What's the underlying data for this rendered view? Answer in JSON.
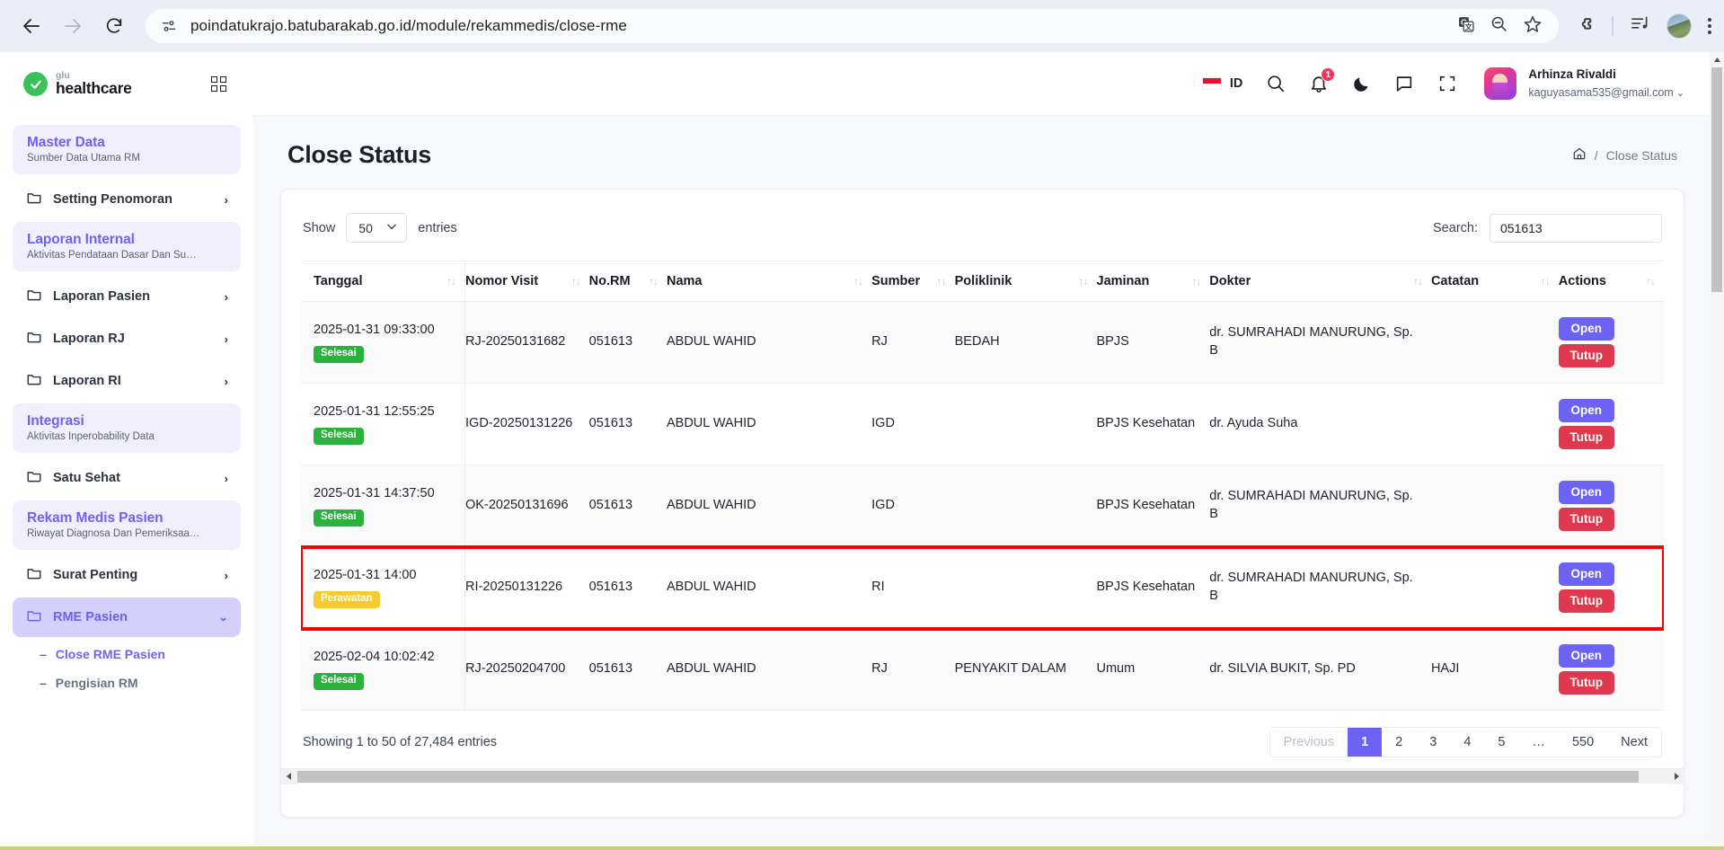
{
  "browser": {
    "url": "poindatukrajo.batubarakab.go.id/module/rekammedis/close-rme",
    "back_label": "Back",
    "forward_label": "Forward",
    "reload_label": "Reload",
    "icons": {
      "site_info": "site-info-icon",
      "translate": "translate-icon",
      "zoom_out": "zoom-out-icon",
      "bookmark": "star-icon",
      "extensions": "puzzle-icon",
      "media": "media-playlist-icon",
      "profile": "chrome-profile-avatar",
      "menu": "kebab-menu-icon"
    }
  },
  "sidebar": {
    "brand": {
      "glu": "glu",
      "name": "healthcare",
      "grid_label": "Apps"
    },
    "groups": [
      {
        "type": "section",
        "title": "Master Data",
        "sub": "Sumber Data Utama RM"
      },
      {
        "type": "item",
        "label": "Setting Penomoran",
        "active": false
      },
      {
        "type": "section",
        "title": "Laporan Internal",
        "sub": "Aktivitas Pendataan Dasar Dan Su…"
      },
      {
        "type": "item",
        "label": "Laporan Pasien",
        "active": false
      },
      {
        "type": "item",
        "label": "Laporan RJ",
        "active": false
      },
      {
        "type": "item",
        "label": "Laporan RI",
        "active": false
      },
      {
        "type": "section",
        "title": "Integrasi",
        "sub": "Aktivitas Inperobability Data"
      },
      {
        "type": "item",
        "label": "Satu Sehat",
        "active": false
      },
      {
        "type": "section",
        "title": "Rekam Medis Pasien",
        "sub": "Riwayat Diagnosa Dan Pemeriksaa…"
      },
      {
        "type": "item",
        "label": "Surat Penting",
        "active": false
      },
      {
        "type": "item",
        "label": "RME Pasien",
        "active": true
      },
      {
        "type": "sub",
        "label": "Close RME Pasien",
        "active": true
      },
      {
        "type": "sub",
        "label": "Pengisian RM",
        "active": false
      }
    ]
  },
  "topbar": {
    "language": "ID",
    "notification_count": "1",
    "user": {
      "name": "Arhinza Rivaldi",
      "email": "kaguyasama535@gmail.com",
      "caret": "⌄"
    },
    "icons": {
      "search": "search-icon",
      "bell": "bell-icon",
      "dark_mode": "moon-icon",
      "chat": "chat-bubble-icon",
      "fullscreen": "fullscreen-icon"
    }
  },
  "page": {
    "title": "Close Status",
    "breadcrumb": {
      "home": "home-icon",
      "separator": "/",
      "current": "Close Status"
    }
  },
  "table_controls": {
    "show_label": "Show",
    "entries_label": "entries",
    "page_size": "50",
    "search_label": "Search:",
    "search_value": "051613",
    "search_placeholder": ""
  },
  "table": {
    "columns": [
      "Tanggal",
      "Nomor Visit",
      "No.RM",
      "Nama",
      "Sumber",
      "Poliklinik",
      "Jaminan",
      "Dokter",
      "Catatan",
      "Actions"
    ],
    "rows": [
      {
        "tanggal": "2025-01-31 09:33:00",
        "status": "Selesai",
        "status_type": "selesai",
        "nomor_visit": "RJ-20250131682",
        "no_rm": "051613",
        "nama": "ABDUL WAHID",
        "sumber": "RJ",
        "poliklinik": "BEDAH",
        "jaminan": "BPJS",
        "dokter": "dr. SUMRAHADI MANURUNG, Sp. B",
        "catatan": "",
        "highlighted": false
      },
      {
        "tanggal": "2025-01-31 12:55:25",
        "status": "Selesai",
        "status_type": "selesai",
        "nomor_visit": "IGD-20250131226",
        "no_rm": "051613",
        "nama": "ABDUL WAHID",
        "sumber": "IGD",
        "poliklinik": "",
        "jaminan": "BPJS Kesehatan",
        "dokter": "dr. Ayuda Suha",
        "catatan": "",
        "highlighted": false
      },
      {
        "tanggal": "2025-01-31 14:37:50",
        "status": "Selesai",
        "status_type": "selesai",
        "nomor_visit": "OK-20250131696",
        "no_rm": "051613",
        "nama": "ABDUL WAHID",
        "sumber": "IGD",
        "poliklinik": "",
        "jaminan": "BPJS Kesehatan",
        "dokter": "dr. SUMRAHADI MANURUNG, Sp. B",
        "catatan": "",
        "highlighted": false
      },
      {
        "tanggal": "2025-01-31 14:00",
        "status": "Perawatan",
        "status_type": "perawatan",
        "nomor_visit": "RI-20250131226",
        "no_rm": "051613",
        "nama": "ABDUL WAHID",
        "sumber": "RI",
        "poliklinik": "",
        "jaminan": "BPJS Kesehatan",
        "dokter": "dr. SUMRAHADI MANURUNG, Sp. B",
        "catatan": "",
        "highlighted": true
      },
      {
        "tanggal": "2025-02-04 10:02:42",
        "status": "Selesai",
        "status_type": "selesai",
        "nomor_visit": "RJ-20250204700",
        "no_rm": "051613",
        "nama": "ABDUL WAHID",
        "sumber": "RJ",
        "poliklinik": "PENYAKIT DALAM",
        "jaminan": "Umum",
        "dokter": "dr. SILVIA BUKIT, Sp. PD",
        "catatan": "HAJI",
        "highlighted": false
      }
    ],
    "action_labels": {
      "open": "Open",
      "close": "Tutup"
    }
  },
  "footer": {
    "showing": "Showing 1 to 50 of 27,484 entries",
    "pagination": {
      "previous": "Previous",
      "next": "Next",
      "pages": [
        "1",
        "2",
        "3",
        "4",
        "5",
        "…",
        "550"
      ],
      "active": "1"
    }
  },
  "colors": {
    "accent": "#6c63f4",
    "danger": "#e0384e",
    "success": "#2bb23c",
    "warning": "#f5cb2e",
    "highlight_outline": "#fa0000"
  }
}
